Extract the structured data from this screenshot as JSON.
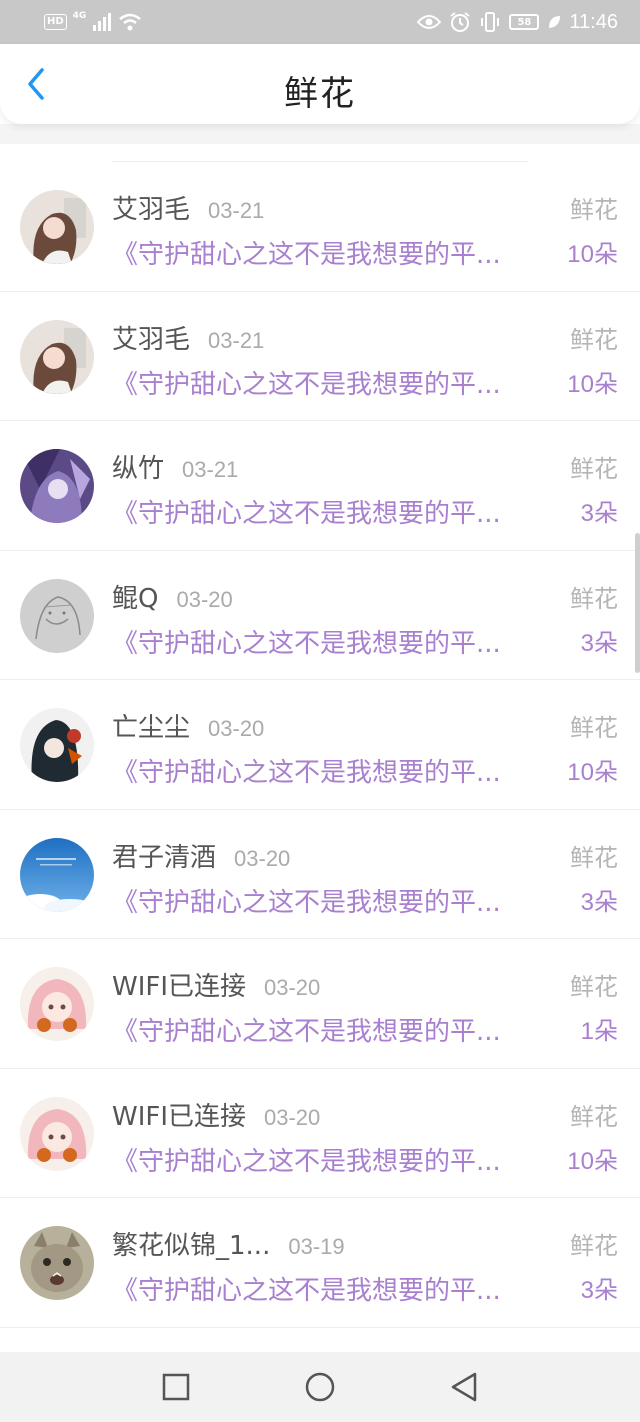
{
  "status_bar": {
    "hd": "HD",
    "network": "4G",
    "battery": "58",
    "time": "11:46"
  },
  "header": {
    "title": "鲜花"
  },
  "colors": {
    "accent_purple": "#a880cf",
    "back_blue": "#2196f3"
  },
  "items": [
    {
      "name": "艾羽毛",
      "date": "03-21",
      "type": "鲜花",
      "book": "《守护甜心之这不是我想要的平...",
      "count": "10朵",
      "avatar": "anime-girl-avatar"
    },
    {
      "name": "艾羽毛",
      "date": "03-21",
      "type": "鲜花",
      "book": "《守护甜心之这不是我想要的平...",
      "count": "10朵",
      "avatar": "anime-girl-avatar"
    },
    {
      "name": "纵竹",
      "date": "03-21",
      "type": "鲜花",
      "book": "《守护甜心之这不是我想要的平...",
      "count": "3朵",
      "avatar": "purple-anime-avatar"
    },
    {
      "name": "鲲Q",
      "date": "03-20",
      "type": "鲜花",
      "book": "《守护甜心之这不是我想要的平...",
      "count": "3朵",
      "avatar": "sketch-avatar"
    },
    {
      "name": "亡尘尘",
      "date": "03-20",
      "type": "鲜花",
      "book": "《守护甜心之这不是我想要的平...",
      "count": "10朵",
      "avatar": "dark-anime-avatar"
    },
    {
      "name": "君子清酒",
      "date": "03-20",
      "type": "鲜花",
      "book": "《守护甜心之这不是我想要的平...",
      "count": "3朵",
      "avatar": "sky-avatar"
    },
    {
      "name": "WIFI已连接",
      "date": "03-20",
      "type": "鲜花",
      "book": "《守护甜心之这不是我想要的平...",
      "count": "1朵",
      "avatar": "pink-anime-avatar"
    },
    {
      "name": "WIFI已连接",
      "date": "03-20",
      "type": "鲜花",
      "book": "《守护甜心之这不是我想要的平...",
      "count": "10朵",
      "avatar": "pink-anime-avatar"
    },
    {
      "name": "繁花似锦_1...",
      "date": "03-19",
      "type": "鲜花",
      "book": "《守护甜心之这不是我想要的平...",
      "count": "3朵",
      "avatar": "cat-avatar"
    }
  ]
}
